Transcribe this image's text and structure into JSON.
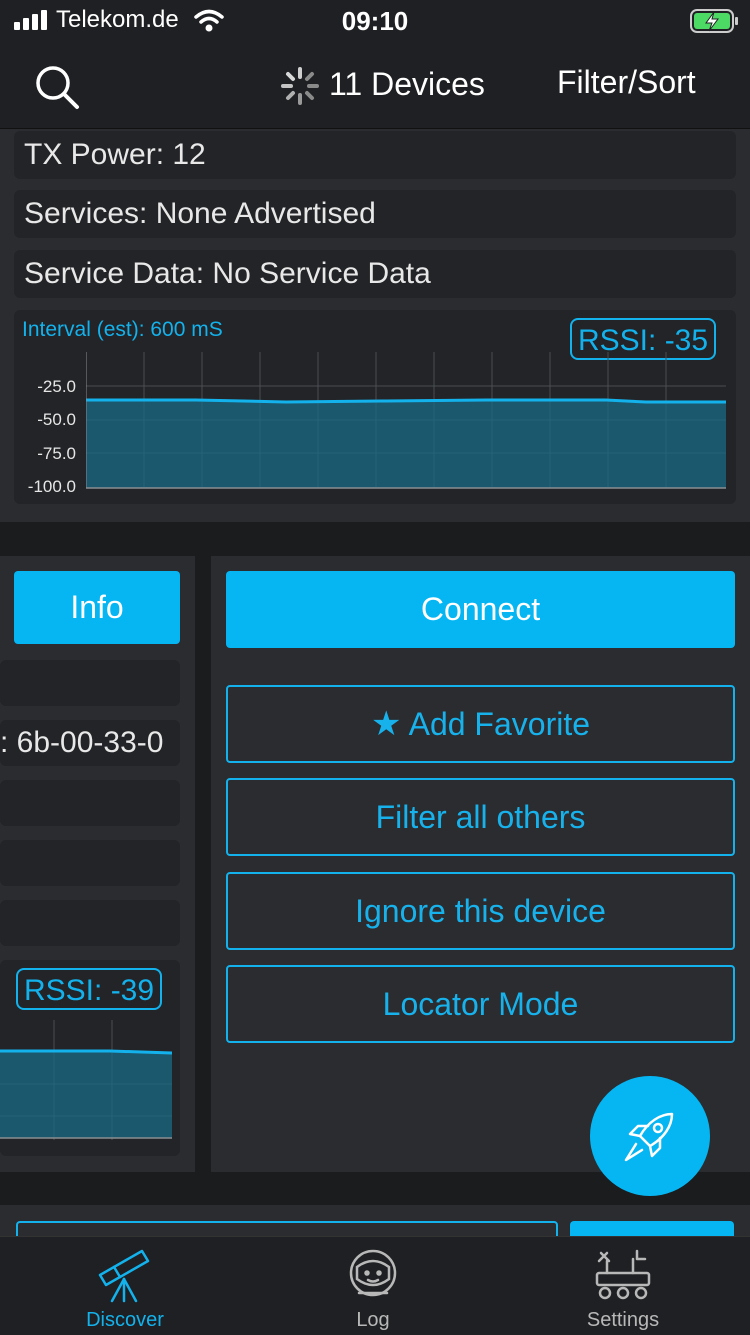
{
  "status": {
    "carrier": "Telekom.de",
    "time": "09:10"
  },
  "nav": {
    "title": "11 Devices",
    "filter_label": "Filter/Sort"
  },
  "device1": {
    "tx_power": "TX Power: 12",
    "services": "Services: None Advertised",
    "service_data": "Service Data: No Service Data",
    "interval": "Interval (est): 600 mS",
    "rssi": "RSSI: -35",
    "yticks": [
      "-25.0",
      "-50.0",
      "-75.0",
      "-100.0"
    ],
    "rssi_value": -35
  },
  "device2": {
    "info_label": "Info",
    "address_partial": ": 6b-00-33-0",
    "rssi": "RSSI: -39",
    "rssi_value": -39
  },
  "actions": {
    "connect": "Connect",
    "favorite_star": "★",
    "add_favorite": "Add Favorite",
    "filter_others": "Filter all others",
    "ignore_device": "Ignore this device",
    "locator_mode": "Locator Mode"
  },
  "tabs": [
    {
      "label": "Discover",
      "active": true
    },
    {
      "label": "Log",
      "active": false
    },
    {
      "label": "Settings",
      "active": false
    }
  ],
  "colors": {
    "accent": "#05b6f3",
    "background": "#1b1c1e",
    "card": "#2b2c2f",
    "inactive_tab": "#b8b8b8"
  }
}
